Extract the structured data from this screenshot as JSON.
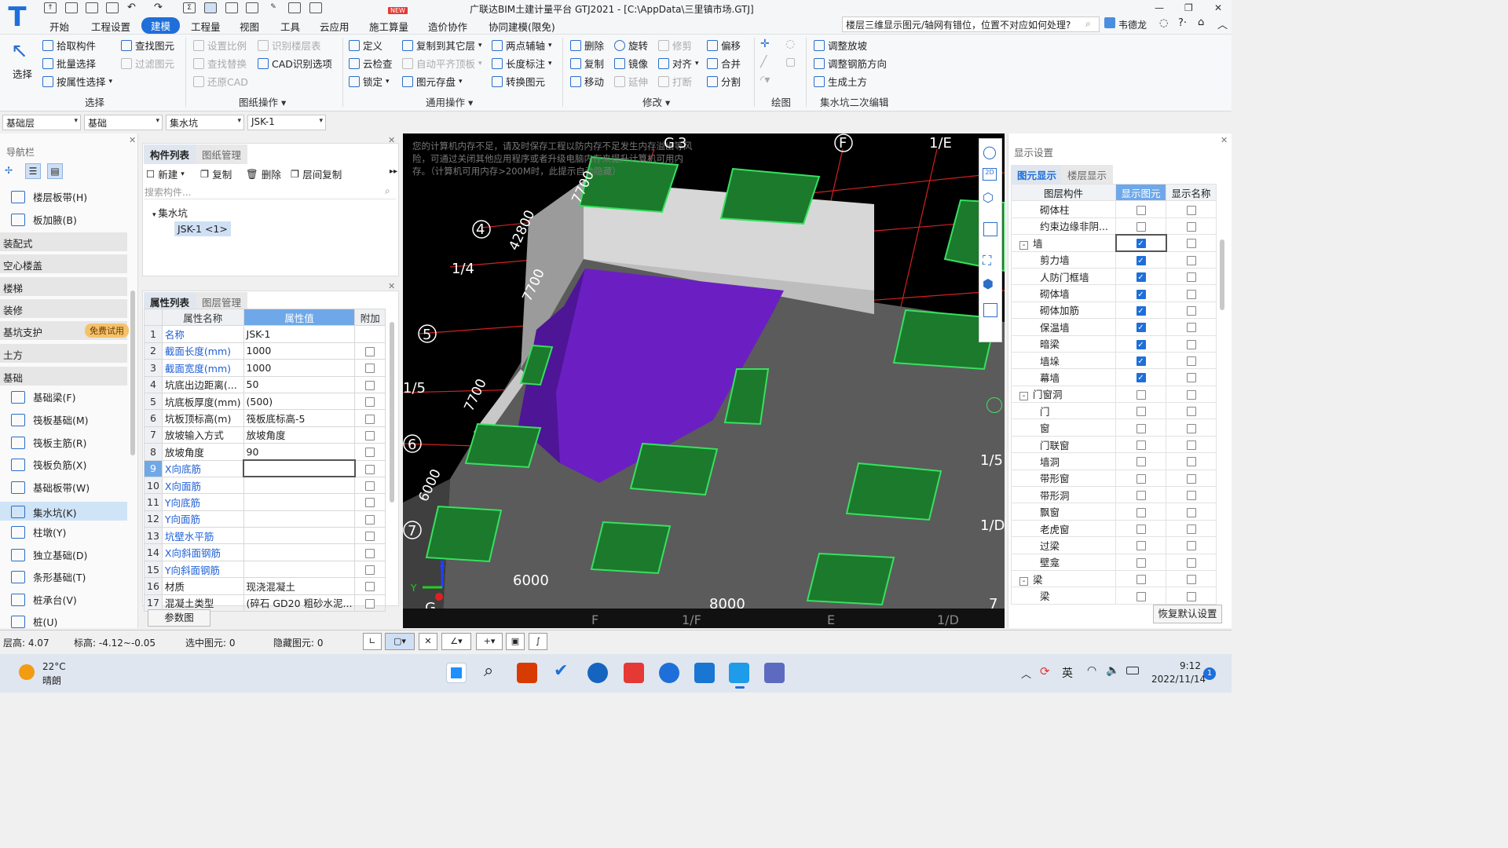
{
  "app": {
    "title": "广联达BIM土建计量平台 GTJ2021 - [C:\\AppData\\三里镇市场.GTJ]",
    "logo": "T",
    "search_text": "楼层三维显示图元/轴网有错位，位置不对应如何处理?",
    "user": "韦德龙",
    "new_badge": "NEW"
  },
  "menu": [
    "开始",
    "工程设置",
    "建模",
    "工程量",
    "视图",
    "工具",
    "云应用",
    "施工算量",
    "造价协作",
    "协同建模(限免)"
  ],
  "active_menu": "建模",
  "ribbon": {
    "select": {
      "big": "选择",
      "items": [
        "拾取构件",
        "批量选择",
        "按属性选择",
        "查找图元",
        "过滤图元"
      ],
      "group": "选择"
    },
    "drawing": {
      "items": [
        "设置比例",
        "识别楼层表",
        "查找替换",
        "CAD识别选项",
        "还原CAD"
      ],
      "group": "图纸操作"
    },
    "common": {
      "items": [
        "定义",
        "复制到其它层",
        "两点辅轴",
        "云检查",
        "自动平齐顶板",
        "长度标注",
        "锁定",
        "图元存盘",
        "转换图元"
      ],
      "group": "通用操作"
    },
    "modify": {
      "items": [
        "删除",
        "旋转",
        "修剪",
        "偏移",
        "复制",
        "镜像",
        "对齐",
        "合并",
        "移动",
        "延伸",
        "打断",
        "分割"
      ],
      "group": "修改"
    },
    "draw": {
      "group": "绘图"
    },
    "pit": {
      "items": [
        "调整放坡",
        "调整钢筋方向",
        "生成土方"
      ],
      "group": "集水坑二次编辑"
    }
  },
  "dropdowns": [
    "基础层",
    "基础",
    "集水坑",
    "JSK-1"
  ],
  "nav": {
    "title": "导航栏",
    "items": [
      {
        "label": "楼层板带(H)",
        "type": "item"
      },
      {
        "label": "板加腋(B)",
        "type": "item"
      },
      {
        "label": "装配式",
        "type": "section"
      },
      {
        "label": "空心楼盖",
        "type": "section"
      },
      {
        "label": "楼梯",
        "type": "section"
      },
      {
        "label": "装修",
        "type": "section"
      },
      {
        "label": "基坑支护",
        "type": "section"
      },
      {
        "label": "土方",
        "type": "section"
      },
      {
        "label": "基础",
        "type": "section"
      },
      {
        "label": "基础梁(F)",
        "type": "item"
      },
      {
        "label": "筏板基础(M)",
        "type": "item"
      },
      {
        "label": "筏板主筋(R)",
        "type": "item"
      },
      {
        "label": "筏板负筋(X)",
        "type": "item"
      },
      {
        "label": "基础板带(W)",
        "type": "item"
      },
      {
        "label": "集水坑(K)",
        "type": "item",
        "selected": true
      },
      {
        "label": "柱墩(Y)",
        "type": "item"
      },
      {
        "label": "独立基础(D)",
        "type": "item"
      },
      {
        "label": "条形基础(T)",
        "type": "item"
      },
      {
        "label": "桩承台(V)",
        "type": "item"
      },
      {
        "label": "桩(U)",
        "type": "item"
      }
    ],
    "free_tag": "免费试用"
  },
  "complist": {
    "tabs": [
      "构件列表",
      "图纸管理"
    ],
    "toolbar": [
      "新建",
      "复制",
      "删除",
      "层间复制"
    ],
    "search_placeholder": "搜索构件...",
    "tree_root": "集水坑",
    "tree_item": "JSK-1 <1>"
  },
  "proplist": {
    "tabs": [
      "属性列表",
      "图层管理"
    ],
    "headers": [
      "属性名称",
      "属性值",
      "附加"
    ],
    "rows": [
      {
        "n": "1",
        "name": "名称",
        "value": "JSK-1",
        "blue": true,
        "cb": false
      },
      {
        "n": "2",
        "name": "截面长度(mm)",
        "value": "1000",
        "blue": true,
        "cb": true
      },
      {
        "n": "3",
        "name": "截面宽度(mm)",
        "value": "1000",
        "blue": true,
        "cb": true
      },
      {
        "n": "4",
        "name": "坑底出边距离(...",
        "value": "50",
        "blue": false,
        "cb": true
      },
      {
        "n": "5",
        "name": "坑底板厚度(mm)",
        "value": "(500)",
        "blue": false,
        "cb": true
      },
      {
        "n": "6",
        "name": "坑板顶标高(m)",
        "value": "筏板底标高-5",
        "blue": false,
        "cb": true
      },
      {
        "n": "7",
        "name": "放坡输入方式",
        "value": "放坡角度",
        "blue": false,
        "cb": true
      },
      {
        "n": "8",
        "name": "放坡角度",
        "value": "90",
        "blue": false,
        "cb": true
      },
      {
        "n": "9",
        "name": "X向底筋",
        "value": "",
        "blue": true,
        "cb": true,
        "sel": true
      },
      {
        "n": "10",
        "name": "X向面筋",
        "value": "",
        "blue": true,
        "cb": true
      },
      {
        "n": "11",
        "name": "Y向底筋",
        "value": "",
        "blue": true,
        "cb": true
      },
      {
        "n": "12",
        "name": "Y向面筋",
        "value": "",
        "blue": true,
        "cb": true
      },
      {
        "n": "13",
        "name": "坑壁水平筋",
        "value": "",
        "blue": true,
        "cb": true
      },
      {
        "n": "14",
        "name": "X向斜面钢筋",
        "value": "",
        "blue": true,
        "cb": true
      },
      {
        "n": "15",
        "name": "Y向斜面钢筋",
        "value": "",
        "blue": true,
        "cb": true
      },
      {
        "n": "16",
        "name": "材质",
        "value": "现浇混凝土",
        "blue": false,
        "cb": true
      },
      {
        "n": "17",
        "name": "混凝土类型",
        "value": "(碎石 GD20 粗砂水泥...",
        "blue": false,
        "cb": true
      }
    ],
    "param_button": "参数图"
  },
  "viewport": {
    "warning": "您的计算机内存不足，请及时保存工程以防内存不足发生内存溢出等风险，可通过关闭其他应用程序或者升级电脑内存来提升计算机可用内存。（计算机可用内存>200M时，此提示自动隐藏）",
    "axis_labels": [
      "G",
      "3",
      "F",
      "1/E",
      "4",
      "1/4",
      "5",
      "1/5",
      "6",
      "7",
      "42800",
      "7700",
      "7700",
      "7700",
      "6000",
      "6000",
      "8000",
      "1/4",
      "1/5",
      "1/D",
      "F",
      "1/F",
      "E",
      "1/D",
      "G",
      "7",
      "6"
    ],
    "colors": {
      "floor": "#595959",
      "wall": "#c8c8c8",
      "pit": "#6b1fc2",
      "footing": "#1c7a2c",
      "footing_edge": "#38e060",
      "axis": "#e02020",
      "bg": "#000000"
    }
  },
  "display": {
    "title": "显示设置",
    "tabs": [
      "图元显示",
      "楼层显示"
    ],
    "headers": [
      "图层构件",
      "显示图元",
      "显示名称"
    ],
    "rows": [
      {
        "label": "砌体柱",
        "indent": 2,
        "show": false,
        "name": false
      },
      {
        "label": "约束边缘非阴...",
        "indent": 2,
        "show": false,
        "name": false
      },
      {
        "label": "墙",
        "indent": 1,
        "tree": "-",
        "show": true,
        "name": false
      },
      {
        "label": "剪力墙",
        "indent": 2,
        "show": true,
        "name": false
      },
      {
        "label": "人防门框墙",
        "indent": 2,
        "show": true,
        "name": false
      },
      {
        "label": "砌体墙",
        "indent": 2,
        "show": true,
        "name": false
      },
      {
        "label": "砌体加筋",
        "indent": 2,
        "show": true,
        "name": false
      },
      {
        "label": "保温墙",
        "indent": 2,
        "show": true,
        "name": false
      },
      {
        "label": "暗梁",
        "indent": 2,
        "show": true,
        "name": false
      },
      {
        "label": "墙垛",
        "indent": 2,
        "show": true,
        "name": false
      },
      {
        "label": "幕墙",
        "indent": 2,
        "show": true,
        "name": false
      },
      {
        "label": "门窗洞",
        "indent": 1,
        "tree": "-",
        "show": false,
        "name": false
      },
      {
        "label": "门",
        "indent": 2,
        "show": false,
        "name": false
      },
      {
        "label": "窗",
        "indent": 2,
        "show": false,
        "name": false
      },
      {
        "label": "门联窗",
        "indent": 2,
        "show": false,
        "name": false
      },
      {
        "label": "墙洞",
        "indent": 2,
        "show": false,
        "name": false
      },
      {
        "label": "带形窗",
        "indent": 2,
        "show": false,
        "name": false
      },
      {
        "label": "带形洞",
        "indent": 2,
        "show": false,
        "name": false
      },
      {
        "label": "飘窗",
        "indent": 2,
        "show": false,
        "name": false
      },
      {
        "label": "老虎窗",
        "indent": 2,
        "show": false,
        "name": false
      },
      {
        "label": "过梁",
        "indent": 2,
        "show": false,
        "name": false
      },
      {
        "label": "壁龛",
        "indent": 2,
        "show": false,
        "name": false
      },
      {
        "label": "梁",
        "indent": 1,
        "tree": "-",
        "show": false,
        "name": false
      },
      {
        "label": "梁",
        "indent": 2,
        "show": false,
        "name": false
      }
    ],
    "restore_button": "恢复默认设置"
  },
  "status": {
    "floor_height": "层高:  4.07",
    "elevation": "标高:  -4.12~-0.05",
    "selected": "选中图元:  0",
    "hidden": "隐藏图元:  0"
  },
  "taskbar": {
    "weather_temp": "22°C",
    "weather_text": "晴朗",
    "ime": "英",
    "time": "9:12",
    "date": "2022/11/14",
    "notif": "1"
  }
}
